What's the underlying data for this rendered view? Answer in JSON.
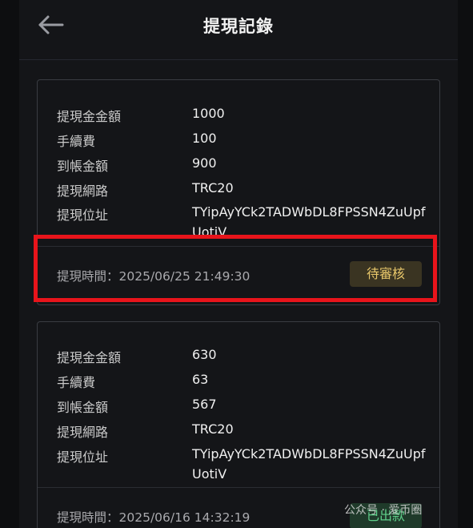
{
  "header": {
    "title": "提現記錄",
    "back_icon": "arrow-left-icon"
  },
  "labels": {
    "amount": "提現金金額",
    "fee": "手續費",
    "arrived": "到帳金額",
    "network": "提現網路",
    "address": "提現位址",
    "time_prefix": "提現時間："
  },
  "records": [
    {
      "amount": "1000",
      "fee": "100",
      "arrived": "900",
      "network": "TRC20",
      "address": "TYipAyYCk2TADWbDL8FPSSN4ZuUpfUotiV",
      "time": "2025/06/25 21:49:30",
      "status": "待審核"
    },
    {
      "amount": "630",
      "fee": "63",
      "arrived": "567",
      "network": "TRC20",
      "address": "TYipAyYCk2TADWbDL8FPSSN4ZuUpfUotiV",
      "time": "2025/06/16 14:32:19",
      "status": "已出款"
    }
  ],
  "watermark": "公众号 · 爱币圈",
  "colors": {
    "highlight": "#e8141b",
    "pending": "#e7c66a",
    "paid": "#5fcf8a"
  }
}
